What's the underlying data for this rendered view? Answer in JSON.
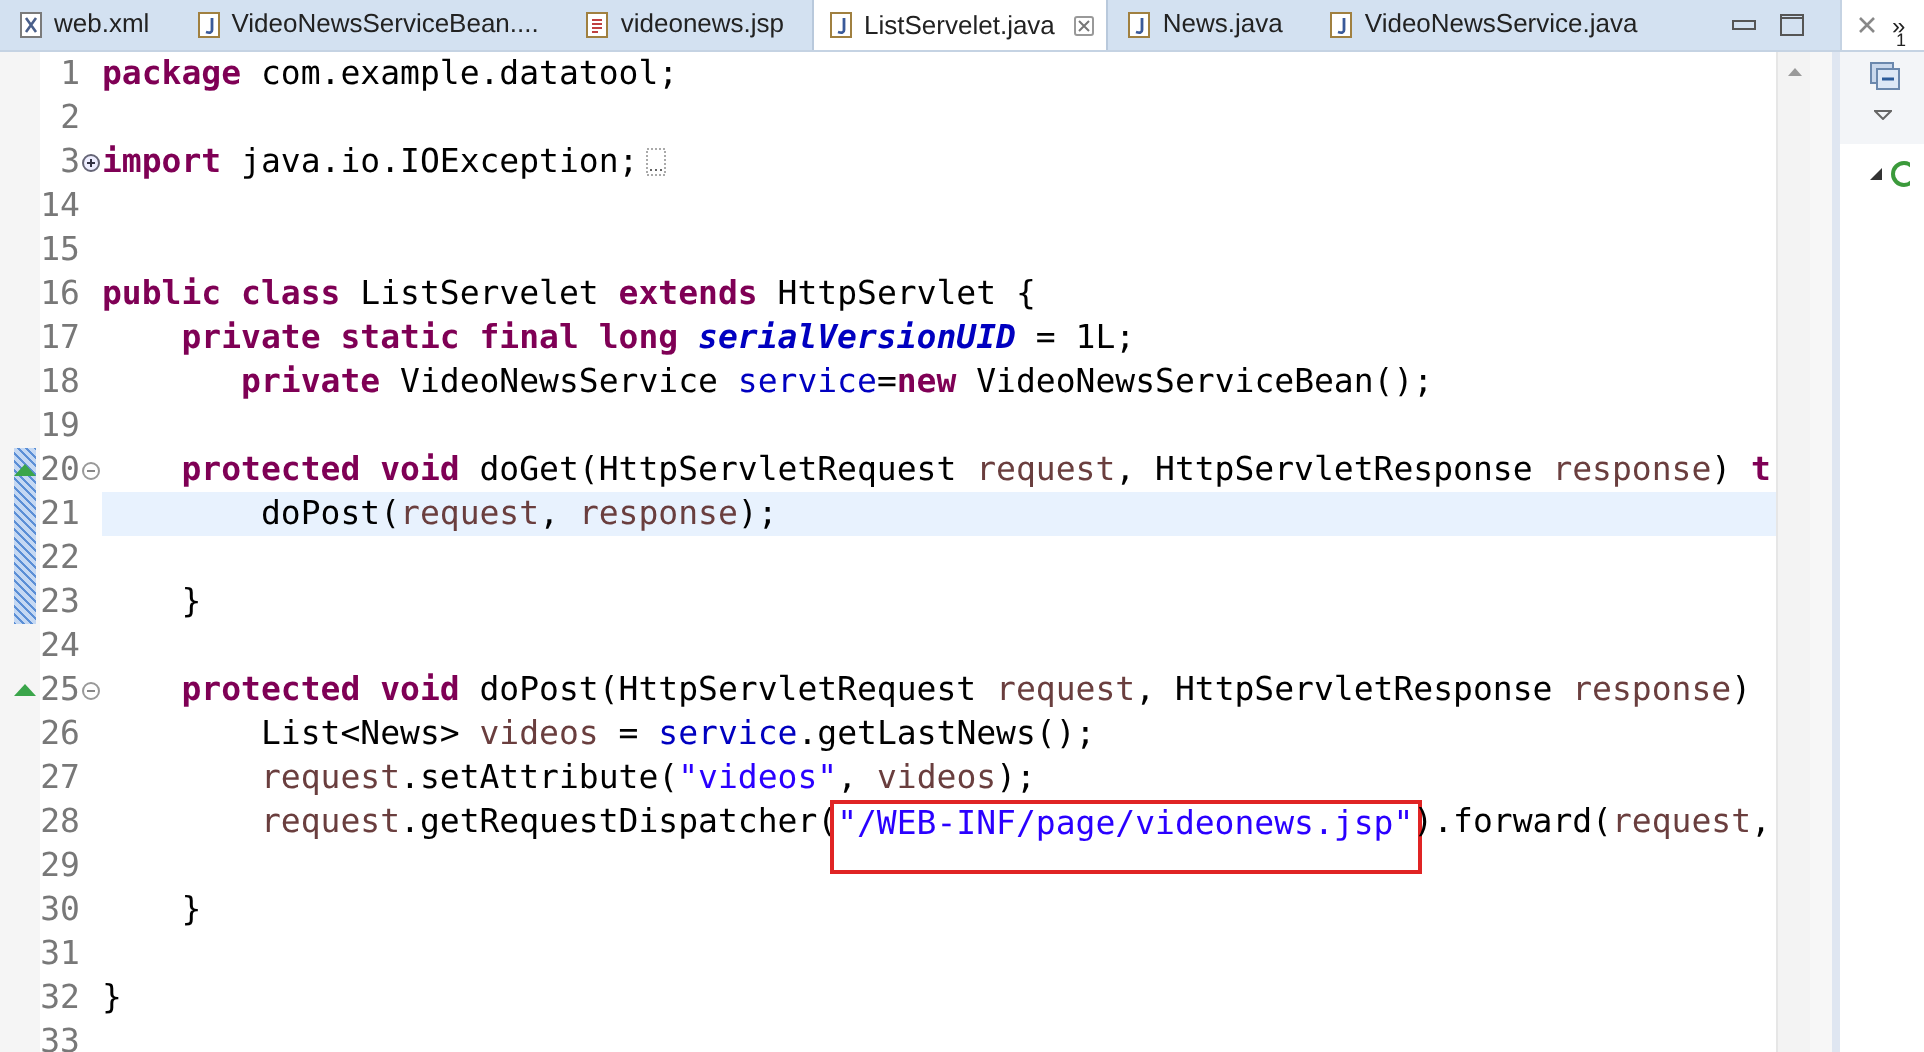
{
  "tabs": [
    {
      "label": "web.xml",
      "kind": "xml",
      "selected": false
    },
    {
      "label": "VideoNewsServiceBean....",
      "kind": "java",
      "selected": false
    },
    {
      "label": "videonews.jsp",
      "kind": "jsp",
      "selected": false
    },
    {
      "label": "ListServelet.java",
      "kind": "java",
      "selected": true
    },
    {
      "label": "News.java",
      "kind": "java",
      "selected": false
    },
    {
      "label": "VideoNewsService.java",
      "kind": "java",
      "selected": false
    }
  ],
  "side_panel": {
    "overflow": "»",
    "overflow_count": "1"
  },
  "lines": [
    {
      "number": "1",
      "tokens": [
        {
          "kind": "kw",
          "text": "package"
        },
        {
          "kind": "plain",
          "text": " com.example.datatool;"
        }
      ]
    },
    {
      "number": "2"
    },
    {
      "number": "3",
      "collapsed": true,
      "tokens": [
        {
          "kind": "kw",
          "text": "import"
        },
        {
          "kind": "plain",
          "text": " java.io.IOException;"
        }
      ]
    },
    {
      "number": "14"
    },
    {
      "number": "15"
    },
    {
      "number": "16",
      "tokens": [
        {
          "kind": "kw",
          "text": "public class"
        },
        {
          "kind": "plain",
          "text": " ListServelet "
        },
        {
          "kind": "kw",
          "text": "extends"
        },
        {
          "kind": "plain",
          "text": " HttpServlet {"
        }
      ]
    },
    {
      "number": "17",
      "tokens": [
        {
          "kind": "kw",
          "text": "    private static final long "
        },
        {
          "kind": "const",
          "text": "serialVersionUID"
        },
        {
          "kind": "plain",
          "text": " = 1L;"
        }
      ]
    },
    {
      "number": "18",
      "tokens": [
        {
          "kind": "kw",
          "text": "       private"
        },
        {
          "kind": "plain",
          "text": " VideoNewsService "
        },
        {
          "kind": "field",
          "text": "service"
        },
        {
          "kind": "plain",
          "text": "="
        },
        {
          "kind": "kw",
          "text": "new"
        },
        {
          "kind": "plain",
          "text": " VideoNewsServiceBean();"
        }
      ]
    },
    {
      "number": "19"
    },
    {
      "number": "20",
      "collapsed": false,
      "override": true,
      "range": true,
      "tokens": [
        {
          "kind": "kw",
          "text": "    protected void"
        },
        {
          "kind": "plain",
          "text": " doGet(HttpServletRequest "
        },
        {
          "kind": "param",
          "text": "request"
        },
        {
          "kind": "plain",
          "text": ", HttpServletResponse "
        },
        {
          "kind": "param",
          "text": "response"
        },
        {
          "kind": "plain",
          "text": ") "
        },
        {
          "kind": "kw",
          "text": "t"
        }
      ]
    },
    {
      "number": "21",
      "current": true,
      "range": true,
      "tokens": [
        {
          "kind": "plain",
          "text": "        doPost("
        },
        {
          "kind": "param",
          "text": "request"
        },
        {
          "kind": "plain",
          "text": ", "
        },
        {
          "kind": "param",
          "text": "response"
        },
        {
          "kind": "plain",
          "text": ");"
        }
      ]
    },
    {
      "number": "22",
      "range": true
    },
    {
      "number": "23",
      "range": true,
      "tokens": [
        {
          "kind": "plain",
          "text": "    }"
        }
      ]
    },
    {
      "number": "24"
    },
    {
      "number": "25",
      "collapsed": false,
      "override": true,
      "tokens": [
        {
          "kind": "kw",
          "text": "    protected void"
        },
        {
          "kind": "plain",
          "text": " doPost(HttpServletRequest "
        },
        {
          "kind": "param",
          "text": "request"
        },
        {
          "kind": "plain",
          "text": ", HttpServletResponse "
        },
        {
          "kind": "param",
          "text": "response"
        },
        {
          "kind": "plain",
          "text": ")"
        }
      ]
    },
    {
      "number": "26",
      "tokens": [
        {
          "kind": "plain",
          "text": "        List<News> "
        },
        {
          "kind": "local",
          "text": "videos"
        },
        {
          "kind": "plain",
          "text": " = "
        },
        {
          "kind": "field",
          "text": "service"
        },
        {
          "kind": "plain",
          "text": ".getLastNews();"
        }
      ]
    },
    {
      "number": "27",
      "tokens": [
        {
          "kind": "param",
          "text": "        request"
        },
        {
          "kind": "plain",
          "text": ".setAttribute("
        },
        {
          "kind": "string",
          "text": "\"videos\""
        },
        {
          "kind": "plain",
          "text": ", "
        },
        {
          "kind": "local",
          "text": "videos"
        },
        {
          "kind": "plain",
          "text": ");"
        }
      ]
    },
    {
      "number": "28",
      "tokens": [
        {
          "kind": "param",
          "text": "        request"
        },
        {
          "kind": "plain",
          "text": ".getRequestDispatcher("
        },
        {
          "kind": "string",
          "text": "\"/WEB-INF/page/videonews.jsp\"",
          "boxed": true
        },
        {
          "kind": "plain",
          "text": ").forward("
        },
        {
          "kind": "param",
          "text": "request"
        },
        {
          "kind": "plain",
          "text": ","
        }
      ]
    },
    {
      "number": "29"
    },
    {
      "number": "30",
      "tokens": [
        {
          "kind": "plain",
          "text": "    }"
        }
      ]
    },
    {
      "number": "31"
    },
    {
      "number": "32",
      "tokens": [
        {
          "kind": "plain",
          "text": "}"
        }
      ]
    },
    {
      "number": "33"
    }
  ]
}
